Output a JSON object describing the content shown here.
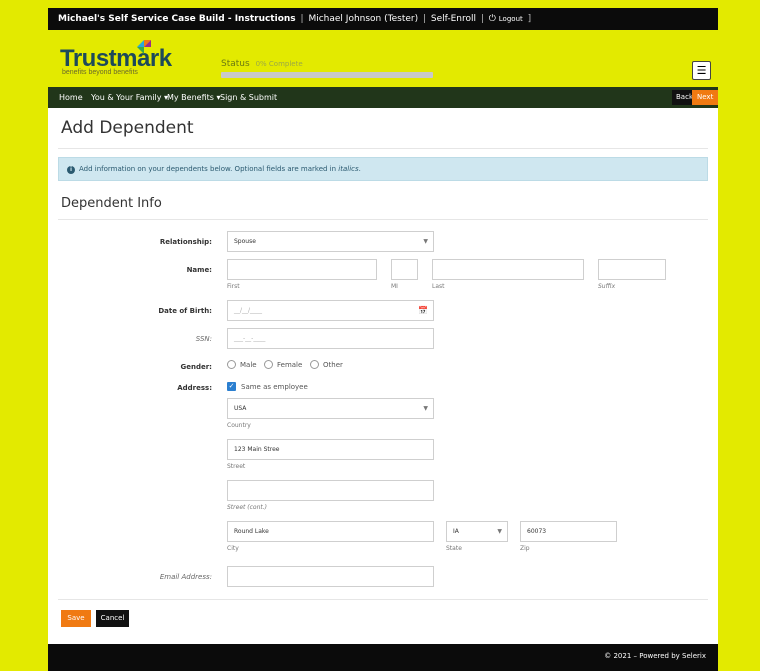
{
  "topbar": {
    "title": "Michael's Self Service Case Build - Instructions",
    "user": "Michael Johnson (Tester)",
    "mode": "Self-Enroll",
    "logout_icon": "power-icon",
    "logout": "Logout"
  },
  "header": {
    "logo": "Trustmark",
    "tagline": "benefits beyond benefits",
    "status_label": "Status",
    "status_detail": "0% Complete",
    "progress_pct": 0,
    "book_icon": "book-icon"
  },
  "nav": {
    "items": [
      "Home",
      "You & Your Family ▾",
      "My Benefits ▾",
      "Sign & Submit"
    ],
    "back": "Back",
    "next": "Next"
  },
  "page": {
    "title": "Add Dependent",
    "alert_text": "Add information on your dependents below. Optional fields are marked in ",
    "alert_em": "italics",
    "alert_end": ".",
    "section": "Dependent Info"
  },
  "form": {
    "relationship_label": "Relationship:",
    "relationship_value": "Spouse",
    "name_label": "Name:",
    "first_hint": "First",
    "mi_hint": "MI",
    "last_hint": "Last",
    "suffix_hint": "Suffix",
    "dob_label": "Date of Birth:",
    "dob_placeholder": "__/__/____",
    "ssn_label": "SSN:",
    "ssn_placeholder": "___-__-____",
    "gender_label": "Gender:",
    "gender_options": [
      "Male",
      "Female",
      "Other"
    ],
    "address_label": "Address:",
    "same_as_employee": "Same as employee",
    "same_as_employee_checked": true,
    "country_value": "USA",
    "country_hint": "Country",
    "street_value": "123 Main Stree",
    "street_hint": "Street",
    "street2_hint": "Street (cont.)",
    "city_value": "Round Lake",
    "city_hint": "City",
    "state_value": "IA",
    "state_hint": "State",
    "zip_value": "60073",
    "zip_hint": "Zip",
    "email_label": "Email Address:"
  },
  "actions": {
    "save": "Save",
    "cancel": "Cancel"
  },
  "footer": {
    "text": "© 2021 – Powered by Selerix"
  },
  "colors": {
    "brand_yellow": "#e3ea00",
    "nav_green": "#21361a",
    "accent_orange": "#f07a12",
    "info_blue": "#cfe7f0"
  }
}
